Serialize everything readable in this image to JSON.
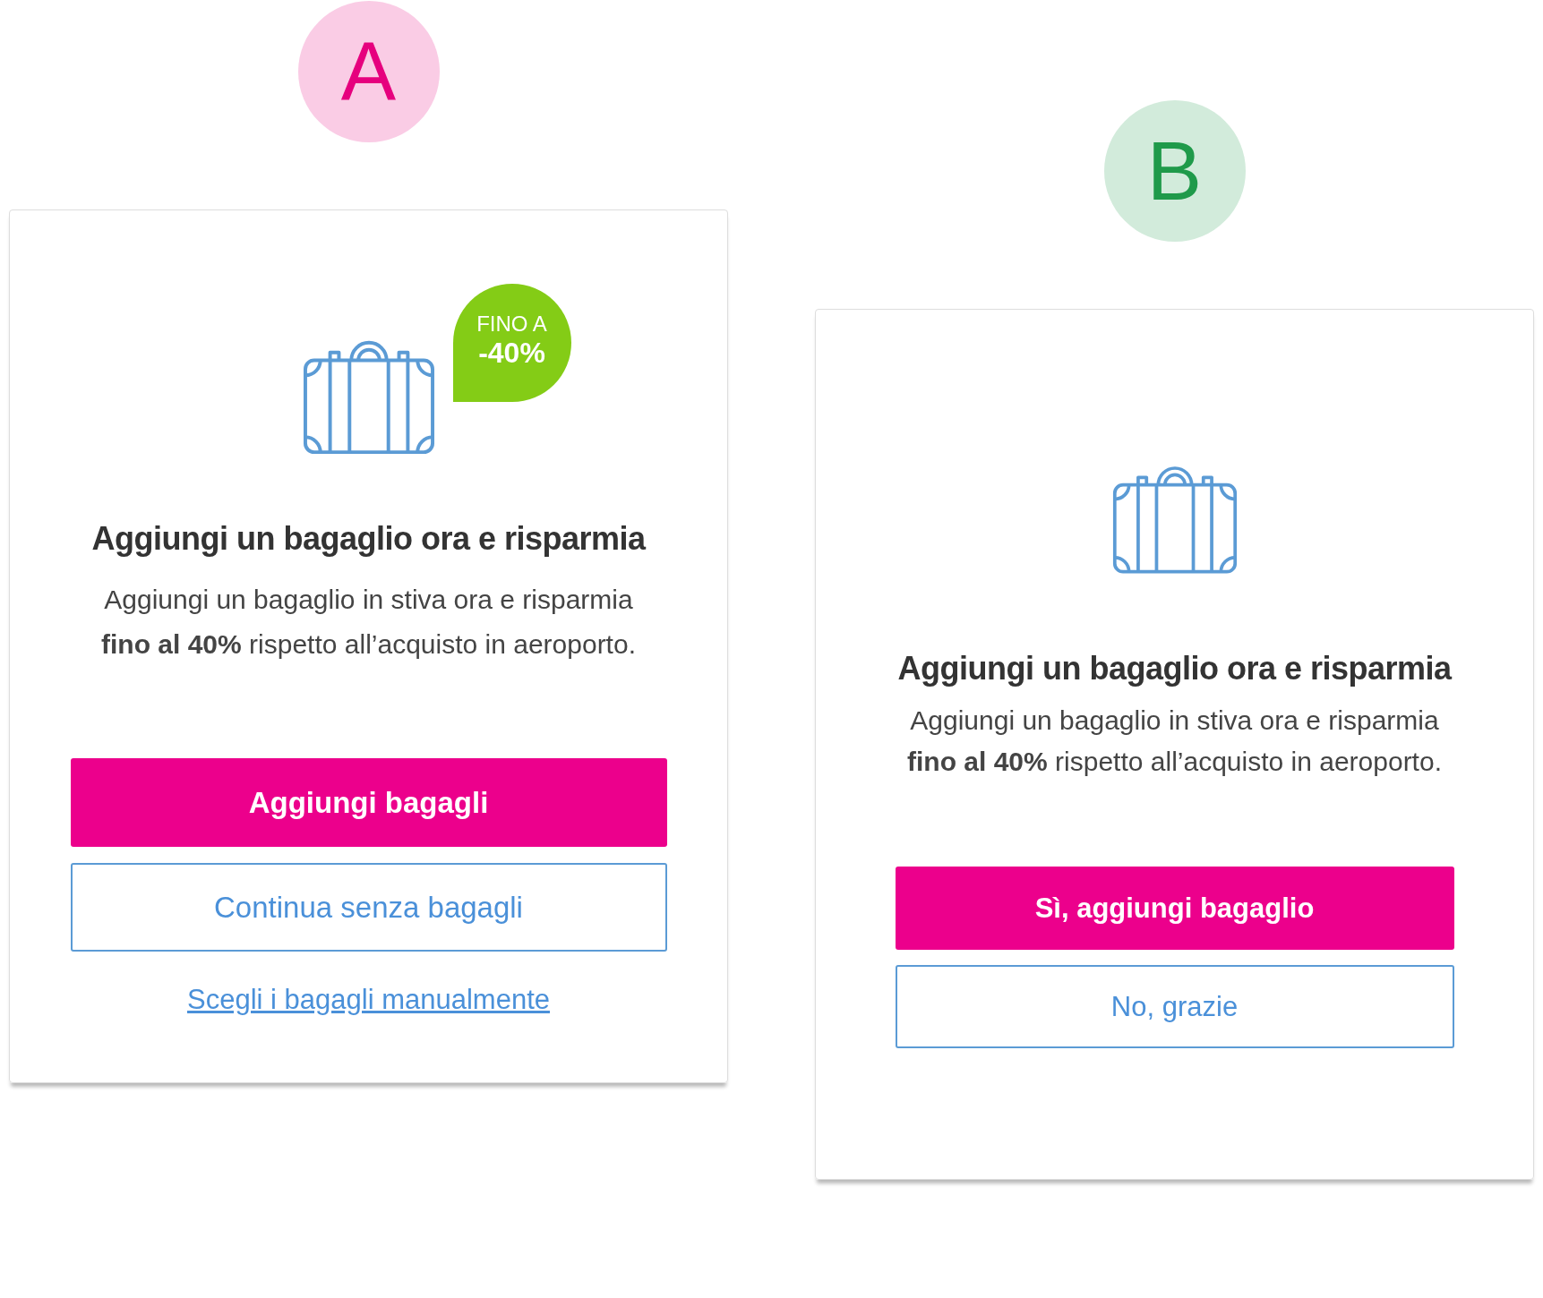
{
  "variants": [
    {
      "label": "A",
      "color": "#e6007e",
      "badge": {
        "line_1": "FINO A",
        "line_2": "-40%"
      },
      "title": "Aggiungi un bagaglio ora e risparmia",
      "body": [
        "Aggiungi un bagaglio in stiva ora e risparmia",
        "**fino al 40%** rispetto all’acquisto in aeroporto."
      ],
      "primary_button": "Aggiungi bagagli",
      "secondary_button": "Continua senza bagagli",
      "link": "Scegli i bagagli manualmente"
    },
    {
      "label": "B",
      "color": "#1f9a4a",
      "title": "Aggiungi un bagaglio ora e risparmia",
      "body": [
        "Aggiungi un bagaglio in stiva ora e risparmia",
        "**fino al 40%** rispetto all’acquisto in aeroporto."
      ],
      "primary_button": "Sì, aggiungi bagaglio",
      "secondary_button": "No, grazie"
    }
  ]
}
